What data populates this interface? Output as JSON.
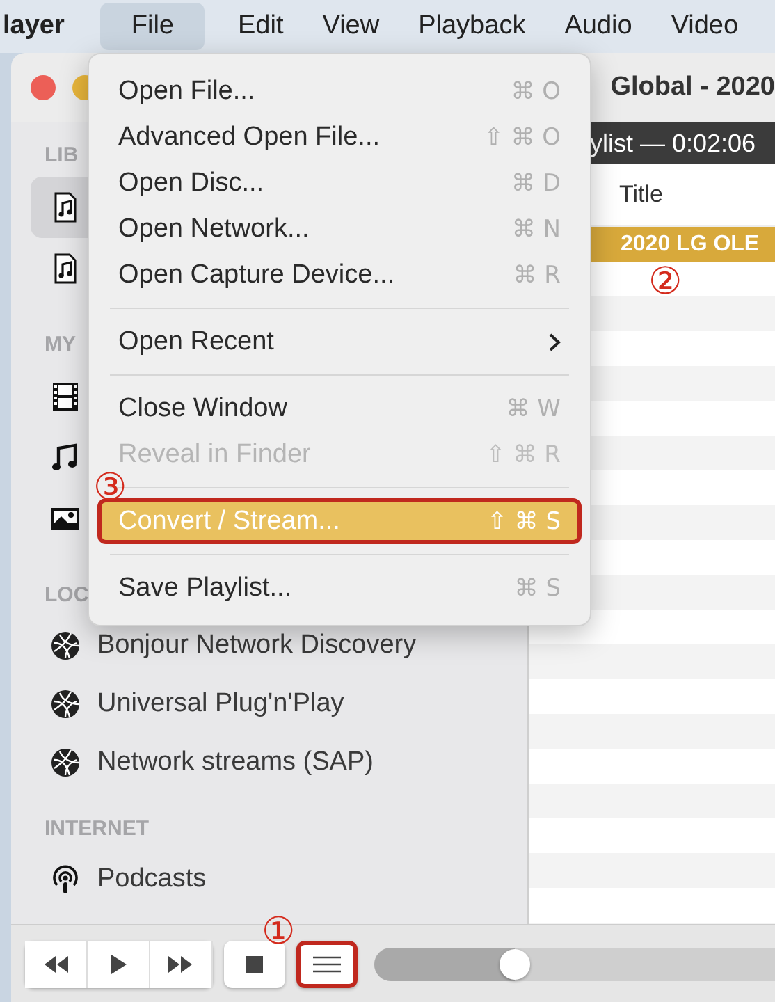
{
  "menu_bar": {
    "items": [
      {
        "label": "layer",
        "kind": "app",
        "selected": false
      },
      {
        "label": "File",
        "kind": "menu",
        "selected": true
      },
      {
        "label": "Edit",
        "kind": "menu",
        "selected": false
      },
      {
        "label": "View",
        "kind": "menu",
        "selected": false
      },
      {
        "label": "Playback",
        "kind": "menu",
        "selected": false
      },
      {
        "label": "Audio",
        "kind": "menu",
        "selected": false
      },
      {
        "label": "Video",
        "kind": "menu",
        "selected": false
      }
    ]
  },
  "window": {
    "title": "Global - 2020"
  },
  "file_menu": {
    "groups": [
      [
        {
          "label": "Open File...",
          "shortcut": "⌘ O",
          "disabled": false,
          "selected": false,
          "outlined": false,
          "submenu": false
        },
        {
          "label": "Advanced Open File...",
          "shortcut": "⇧ ⌘ O",
          "disabled": false,
          "selected": false,
          "outlined": false,
          "submenu": false
        },
        {
          "label": "Open Disc...",
          "shortcut": "⌘ D",
          "disabled": false,
          "selected": false,
          "outlined": false,
          "submenu": false
        },
        {
          "label": "Open Network...",
          "shortcut": "⌘ N",
          "disabled": false,
          "selected": false,
          "outlined": false,
          "submenu": false
        },
        {
          "label": "Open Capture Device...",
          "shortcut": "⌘ R",
          "disabled": false,
          "selected": false,
          "outlined": false,
          "submenu": false
        }
      ],
      [
        {
          "label": "Open Recent",
          "disabled": false,
          "selected": false,
          "outlined": false,
          "submenu": true
        }
      ],
      [
        {
          "label": "Close Window",
          "shortcut": "⌘ W",
          "disabled": false,
          "selected": false,
          "outlined": false,
          "submenu": false
        },
        {
          "label": "Reveal in Finder",
          "shortcut": "⇧ ⌘ R",
          "disabled": true,
          "selected": false,
          "outlined": false,
          "submenu": false
        }
      ],
      [
        {
          "label": "Convert / Stream...",
          "shortcut": "⇧ ⌘ S",
          "disabled": false,
          "selected": true,
          "outlined": true,
          "submenu": false,
          "annotation": "③"
        }
      ],
      [
        {
          "label": "Save Playlist...",
          "shortcut": "⌘ S",
          "disabled": false,
          "selected": false,
          "outlined": false,
          "submenu": false
        }
      ]
    ]
  },
  "sidebar": {
    "sections": [
      {
        "label": "LIB",
        "items": [
          {
            "kind": "music-file",
            "selected": true
          },
          {
            "kind": "music-file",
            "selected": false
          }
        ]
      },
      {
        "label": "MY",
        "items": [
          {
            "kind": "film",
            "selected": false
          },
          {
            "kind": "music",
            "selected": false
          },
          {
            "kind": "picture",
            "selected": false
          }
        ]
      },
      {
        "label": "LOC",
        "items": [
          {
            "kind": "network",
            "label": "Bonjour Network Discovery",
            "selected": false
          },
          {
            "kind": "network",
            "label": "Universal Plug'n'Play",
            "selected": false
          },
          {
            "kind": "network",
            "label": "Network streams (SAP)",
            "selected": false
          }
        ]
      },
      {
        "label": "INTERNET",
        "items": [
          {
            "kind": "podcast",
            "label": "Podcasts",
            "selected": false
          }
        ]
      }
    ]
  },
  "playlist": {
    "header": "ylist — 0:02:06",
    "columns": [
      "Title"
    ],
    "rows": [
      {
        "title": "2020 LG OLE",
        "selected": true,
        "annotation": "②"
      }
    ]
  },
  "controls": {
    "buttons": [
      {
        "kind": "rewind",
        "outlined": false
      },
      {
        "kind": "play",
        "outlined": false
      },
      {
        "kind": "forward",
        "outlined": false
      },
      {
        "kind": "stop",
        "outlined": false
      },
      {
        "kind": "playlist",
        "outlined": true,
        "annotation": "①"
      }
    ],
    "seek": {
      "level": 0.35
    }
  }
}
